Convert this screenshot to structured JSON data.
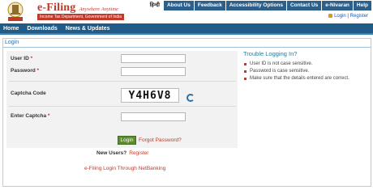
{
  "header": {
    "brand_title": "e-Filing",
    "brand_tagline": "Anywhere Anytime",
    "brand_subtitle": "Income Tax Department, Government of India",
    "emblem_icon": "national-emblem-icon",
    "top_nav": [
      {
        "label": "हिन्दी"
      },
      {
        "label": "About Us"
      },
      {
        "label": "Feedback"
      },
      {
        "label": "Accessibility Options"
      },
      {
        "label": "Contact Us"
      },
      {
        "label": "e-Nivaran"
      },
      {
        "label": "Help"
      }
    ],
    "login_link": "Login",
    "separator": "|",
    "register_link": "Register"
  },
  "main_nav": [
    {
      "label": "Home"
    },
    {
      "label": "Downloads"
    },
    {
      "label": "News & Updates"
    }
  ],
  "section_title": "Login",
  "form": {
    "user_id_label": "User ID",
    "password_label": "Password",
    "captcha_label": "Captcha Code",
    "captcha_value": "Y4H6V8",
    "enter_captcha_label": "Enter Captcha",
    "required_mark": "*",
    "user_id_value": "",
    "password_value": "",
    "captcha_input_value": ""
  },
  "actions": {
    "login_button": "Login",
    "forgot_password": "Forgot Password?",
    "new_users_label": "New Users?",
    "register_link": "Register",
    "netbanking_link": "e-Filing Login Through NetBanking"
  },
  "trouble": {
    "title": "Trouble Logging In?",
    "items": [
      {
        "text": "User ID is not case sensitive."
      },
      {
        "text": "Password is case sensitive."
      },
      {
        "text": "Make sure that the details entered are correct."
      }
    ]
  },
  "colors": {
    "brand_red": "#c0392b",
    "nav_blue": "#1f5c8a",
    "top_nav_blue": "#2d5f8b",
    "login_green": "#5e8c2e"
  }
}
